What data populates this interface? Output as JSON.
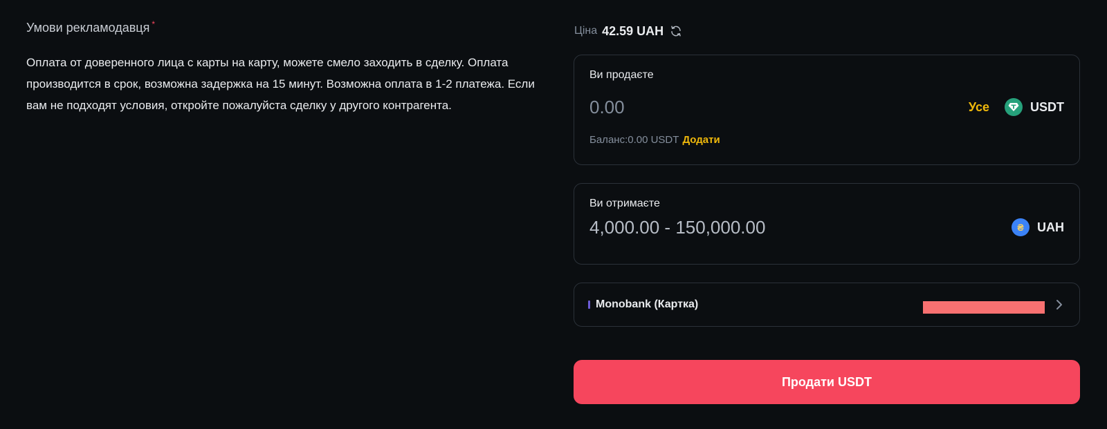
{
  "terms": {
    "title": "Умови рекламодавця",
    "required_mark": "*",
    "text": "Оплата от доверенного лица с карты на карту, можете смело заходить в сделку. Оплата производится в срок, возможна задержка на 15 минут. Возможна оплата в 1-2 платежа. Если вам не подходят условия, откройте пожалуйста сделку у другого контрагента."
  },
  "price": {
    "label": "Ціна",
    "value": "42.59 UAH",
    "refresh_icon": "refresh-icon"
  },
  "sell_card": {
    "label": "Ви продаєте",
    "amount_placeholder": "0.00",
    "max_label": "Усе",
    "coin": "USDT",
    "coin_icon": "tether-icon",
    "balance_label": "Баланс:0.00 USDT",
    "deposit_label": "Додати"
  },
  "receive_card": {
    "label": "Ви отримаєте",
    "range": "4,000.00 - 150,000.00",
    "coin": "UAH",
    "coin_icon": "hryvnia-icon",
    "coin_symbol": "₴"
  },
  "payment": {
    "method": "Monobank (Картка)",
    "chevron_icon": "chevron-right-icon"
  },
  "actions": {
    "sell_label": "Продати USDT"
  },
  "colors": {
    "background": "#0b0e11",
    "accent_yellow": "#f0b90b",
    "sell_red": "#f6465d",
    "border": "#2b3139"
  }
}
